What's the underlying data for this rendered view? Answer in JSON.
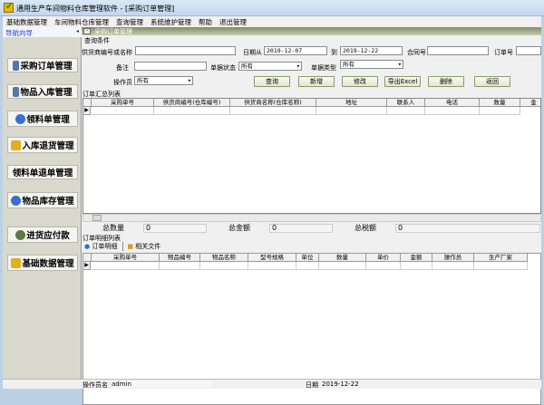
{
  "window": {
    "title": "通用生产车间物料仓库管理软件  - [采购订单管理]"
  },
  "menu": [
    "基础数据管理",
    "车间物料仓库管理",
    "查询管理",
    "系统维护管理",
    "帮助",
    "退出管理"
  ],
  "nav": {
    "title": "导航向导",
    "items": [
      "采购订单管理",
      "物品入库管理",
      "领料单管理",
      "入库退货管理",
      "领料单退单管理",
      "物品库存管理",
      "进货应付款",
      "基础数据管理"
    ]
  },
  "panel": {
    "title": "采购订单管理"
  },
  "query": {
    "group_label": "查询条件",
    "supplier_label": "供货商编号或名称",
    "supplier_value": "",
    "date_from_label": "日期从",
    "date_from": "2019-12-07",
    "date_to_label": "到",
    "date_to": "2019-12-22",
    "contract_label": "合同号",
    "contract_value": "",
    "order_label": "订单号",
    "order_value": "",
    "remark_label": "备注",
    "remark_value": "",
    "status_label": "单据状态",
    "status_value": "所有",
    "type_label": "单据类型",
    "type_value": "所有",
    "operator_label": "操作员",
    "operator_value": "所有"
  },
  "buttons": {
    "query": "查询",
    "add": "新增",
    "edit": "修改",
    "export": "导出Excel",
    "delete": "删除",
    "back": "返回"
  },
  "order_list": {
    "label": "订单汇总列表",
    "columns": [
      "采购单号",
      "供货商编号(仓库编号)",
      "供货商名称(仓库名称)",
      "地址",
      "联系人",
      "电话",
      "数量",
      "金"
    ]
  },
  "totals": {
    "qty_label": "总数量",
    "qty": "0",
    "amount_label": "总金额",
    "amount": "0",
    "tax_label": "总税额",
    "tax": "0"
  },
  "detail": {
    "label": "订单明细列表",
    "tabs": [
      "订单明细",
      "相关文件"
    ],
    "columns": [
      "采购单号",
      "物品编号",
      "物品名称",
      "型号规格",
      "单位",
      "数量",
      "单价",
      "金额",
      "操作员",
      "生产厂家"
    ]
  },
  "status": {
    "operator_label": "操作员名",
    "operator": "admin",
    "date_label": "日期",
    "date": "2019-12-22"
  }
}
